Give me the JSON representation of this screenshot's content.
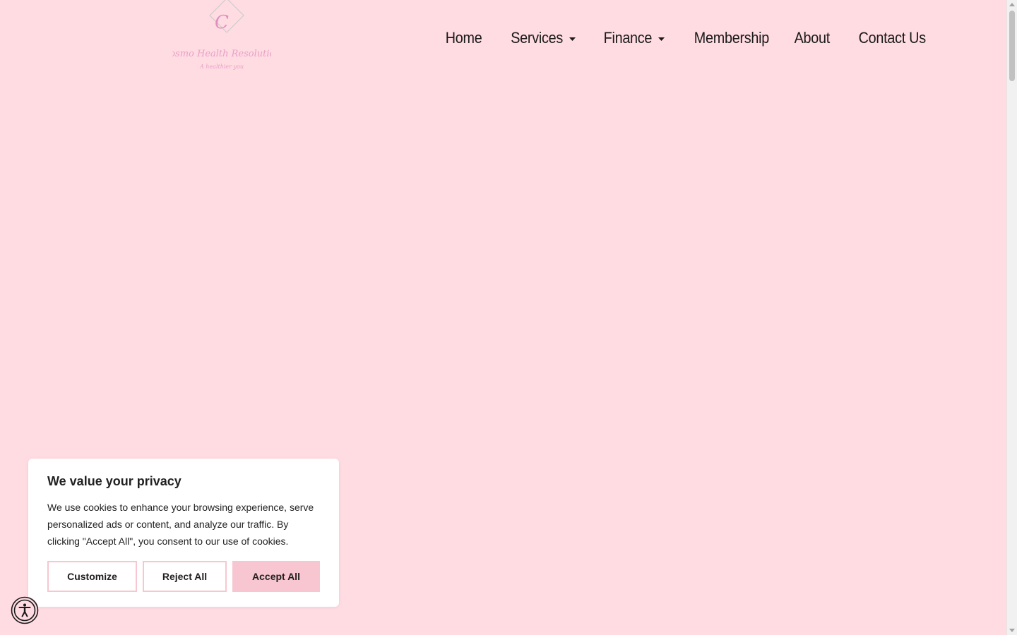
{
  "logo": {
    "letter": "C",
    "name": "Cosmo Health Resolution",
    "tagline": "A healthier you"
  },
  "nav": {
    "items": [
      {
        "label": "Home",
        "has_dropdown": false
      },
      {
        "label": "Services",
        "has_dropdown": true
      },
      {
        "label": "Finance",
        "has_dropdown": true
      },
      {
        "label": "Membership",
        "has_dropdown": false
      },
      {
        "label": "About",
        "has_dropdown": false
      },
      {
        "label": "Contact Us",
        "has_dropdown": false
      }
    ]
  },
  "cookie_banner": {
    "title": "We value your privacy",
    "text": "We use cookies to enhance your browsing experience, serve personalized ads or content, and analyze our traffic. By clicking \"Accept All\", you consent to our use of cookies.",
    "customize_label": "Customize",
    "reject_label": "Reject All",
    "accept_label": "Accept All"
  },
  "colors": {
    "page_background": "#ffdbe2",
    "accent_pink": "#f7c6d0",
    "logo_pink": "#e8a0c8",
    "text_dark": "#1a1a1a"
  },
  "icons": {
    "accessibility": "accessibility-icon",
    "dropdown": "caret-down-icon"
  }
}
